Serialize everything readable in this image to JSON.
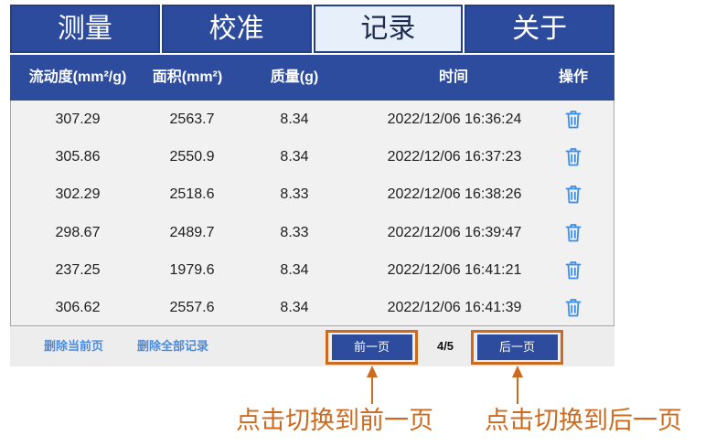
{
  "tabs": [
    {
      "label": "测量",
      "selected": false
    },
    {
      "label": "校准",
      "selected": false
    },
    {
      "label": "记录",
      "selected": true
    },
    {
      "label": "关于",
      "selected": false
    }
  ],
  "table": {
    "headers": [
      "流动度(mm²/g)",
      "面积(mm²)",
      "质量(g)",
      "时间",
      "操作"
    ],
    "action_icon": "trash-icon",
    "rows": [
      {
        "flow": "307.29",
        "area": "2563.7",
        "mass": "8.34",
        "time": "2022/12/06 16:36:24"
      },
      {
        "flow": "305.86",
        "area": "2550.9",
        "mass": "8.34",
        "time": "2022/12/06 16:37:23"
      },
      {
        "flow": "302.29",
        "area": "2518.6",
        "mass": "8.33",
        "time": "2022/12/06 16:38:26"
      },
      {
        "flow": "298.67",
        "area": "2489.7",
        "mass": "8.33",
        "time": "2022/12/06 16:39:47"
      },
      {
        "flow": "237.25",
        "area": "1979.6",
        "mass": "8.34",
        "time": "2022/12/06 16:41:21"
      },
      {
        "flow": "306.62",
        "area": "2557.6",
        "mass": "8.34",
        "time": "2022/12/06 16:41:39"
      }
    ]
  },
  "footer": {
    "delete_page_label": "删除当前页",
    "delete_all_label": "删除全部记录",
    "prev_label": "前一页",
    "page_indicator": "4/5",
    "next_label": "后一页"
  },
  "annotations": {
    "prev_hint": "点击切换到前一页",
    "next_hint": "点击切换到后一页",
    "arrow_icon": "arrow-up-icon"
  },
  "colors": {
    "tab_bg": "#2D4B9C",
    "tab_border": "#243F86",
    "tab_selected_bg": "#E7EFFA",
    "tab_selected_text": "#1D2B4E",
    "header_bg": "#2E4C9E",
    "body_bg": "#F1F1F1",
    "footer_bg": "#EDEDED",
    "link": "#4A8CE0",
    "button_bg": "#2E4C9E",
    "trash_icon": "#3A8DEB",
    "annotation": "#CE6A1E"
  }
}
